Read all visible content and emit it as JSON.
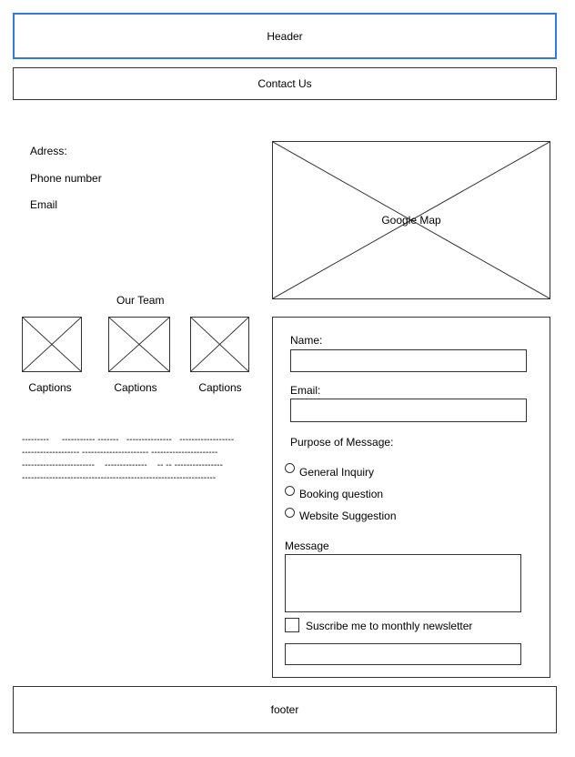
{
  "header": {
    "label": "Header"
  },
  "nav": {
    "contact_label": "Contact Us"
  },
  "contact_info": {
    "address_label": "Adress:",
    "phone_label": "Phone number",
    "email_label": "Email"
  },
  "map": {
    "label": "Google Map"
  },
  "team": {
    "title": "Our Team",
    "captions": [
      "Captions",
      "Captions",
      "Captions"
    ],
    "text_lines": [
      "---------     ----------- -------   ---------------   ------------------",
      "------------------- ---------------------- ----------------------",
      "------------------------    --------------    -- -- ----------------",
      "----------------------------------------------------------------"
    ]
  },
  "form": {
    "name_label": "Name:",
    "name_value": "",
    "email_label": "Email:",
    "email_value": "",
    "purpose_label": "Purpose of Message:",
    "purpose_options": [
      "General Inquiry",
      "Booking question",
      "Website Suggestion"
    ],
    "message_label": "Message",
    "message_value": "",
    "newsletter_label": "Suscribe me to monthly newsletter",
    "submit_value": ""
  },
  "footer": {
    "label": "footer"
  },
  "colors": {
    "header_border": "#2f7bd6",
    "line": "#333333"
  }
}
